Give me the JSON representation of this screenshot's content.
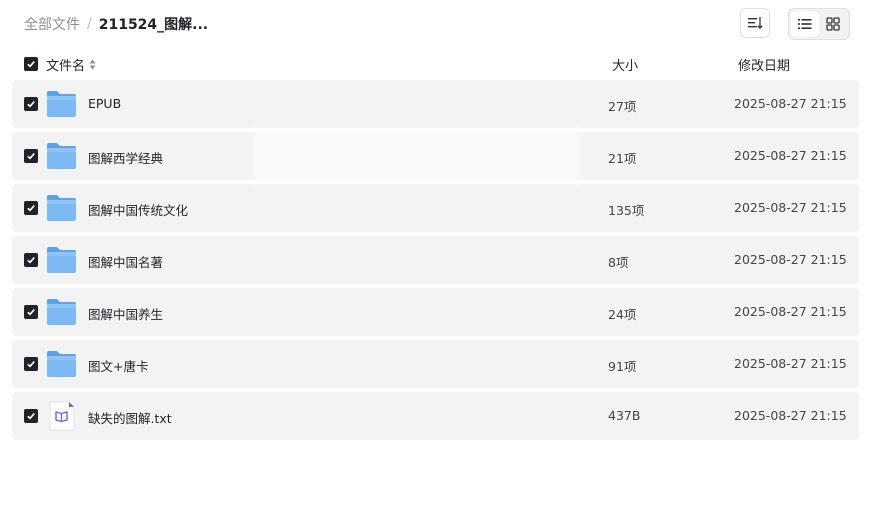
{
  "breadcrumb": {
    "root": "全部文件",
    "separator": "/",
    "current": "211524_图解..."
  },
  "toolbar": {
    "sort_icon": "sort-icon",
    "list_view_icon": "list-view-icon",
    "grid_view_icon": "grid-view-icon",
    "active_view": "list"
  },
  "table": {
    "headers": {
      "name": "文件名",
      "size": "大小",
      "date": "修改日期"
    },
    "rows": [
      {
        "name": "EPUB",
        "type": "folder",
        "size": "27项",
        "date": "2025-08-27 21:15",
        "checked": true
      },
      {
        "name": "图解西学经典",
        "type": "folder",
        "size": "21项",
        "date": "2025-08-27 21:15",
        "checked": true
      },
      {
        "name": "图解中国传统文化",
        "type": "folder",
        "size": "135项",
        "date": "2025-08-27 21:15",
        "checked": true
      },
      {
        "name": "图解中国名著",
        "type": "folder",
        "size": "8项",
        "date": "2025-08-27 21:15",
        "checked": true
      },
      {
        "name": "图解中国养生",
        "type": "folder",
        "size": "24项",
        "date": "2025-08-27 21:15",
        "checked": true
      },
      {
        "name": "图文+唐卡",
        "type": "folder",
        "size": "91项",
        "date": "2025-08-27 21:15",
        "checked": true
      },
      {
        "name": "缺失的图解.txt",
        "type": "txt-file",
        "size": "437B",
        "date": "2025-08-27 21:15",
        "checked": true
      }
    ]
  },
  "colors": {
    "folder": "#7cb8f2",
    "folder_dark": "#5aa2ea",
    "txt_accent": "#7b5ce0",
    "checkbox": "#1f2329",
    "row_bg": "#f3f3f4"
  }
}
